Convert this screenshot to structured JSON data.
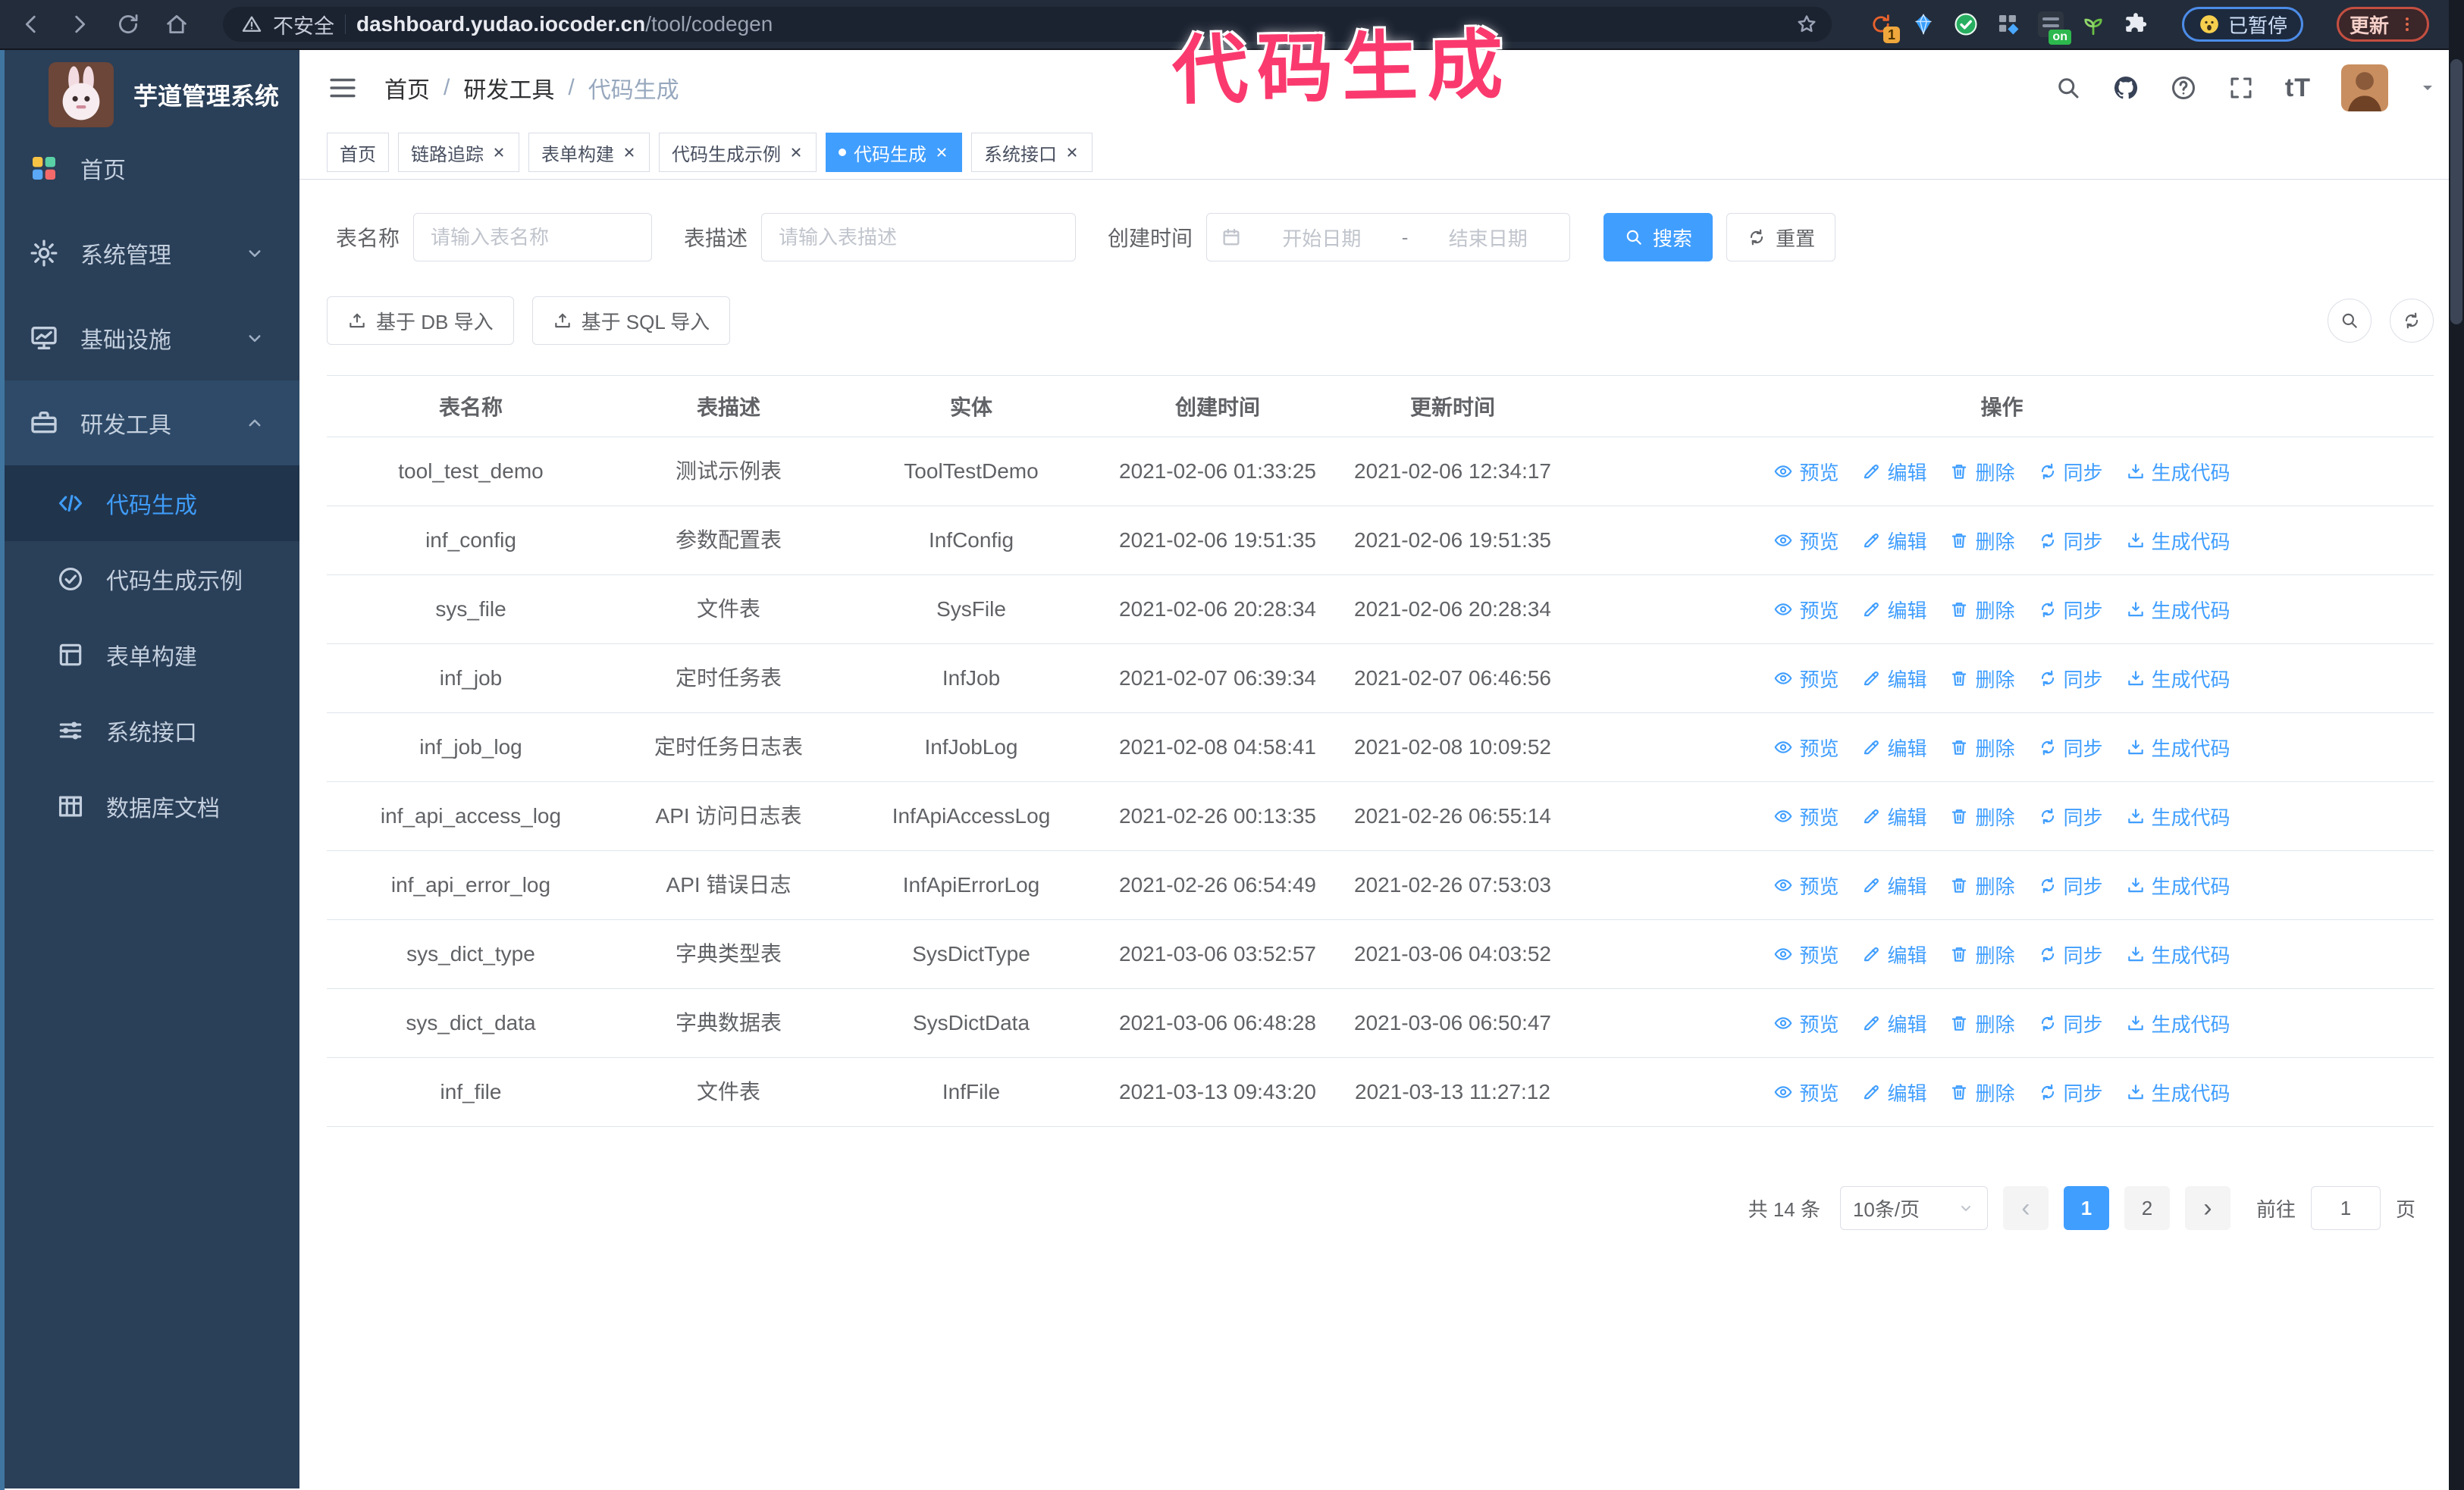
{
  "browser": {
    "security_label": "不安全",
    "url_host": "dashboard.yudao.iocoder.cn",
    "url_path": "/tool/codegen",
    "extension_badge": "1",
    "extension_on_label": "on",
    "paused_label": "已暂停",
    "update_label": "更新"
  },
  "annotation": {
    "text": "代码生成",
    "color": "#fa3a6e"
  },
  "sidebar": {
    "title": "芋道管理系统",
    "items": [
      {
        "key": "home",
        "label": "首页",
        "icon": "dashboard-icon",
        "chevron": null,
        "highlight": false
      },
      {
        "key": "system",
        "label": "系统管理",
        "icon": "gear-icon",
        "chevron": "down",
        "highlight": false
      },
      {
        "key": "infrastructure",
        "label": "基础设施",
        "icon": "monitor-icon",
        "chevron": "down",
        "highlight": false
      },
      {
        "key": "dev-tools",
        "label": "研发工具",
        "icon": "toolbox-icon",
        "chevron": "up",
        "highlight": true
      }
    ],
    "subitems": [
      {
        "key": "codegen",
        "label": "代码生成",
        "icon": "code-icon",
        "active": true
      },
      {
        "key": "codegen-example",
        "label": "代码生成示例",
        "icon": "badge-icon",
        "active": false
      },
      {
        "key": "form-builder",
        "label": "表单构建",
        "icon": "form-icon",
        "active": false
      },
      {
        "key": "system-api",
        "label": "系统接口",
        "icon": "sliders-icon",
        "active": false
      },
      {
        "key": "db-doc",
        "label": "数据库文档",
        "icon": "table-icon",
        "active": false
      }
    ]
  },
  "header": {
    "breadcrumb": [
      "首页",
      "研发工具",
      "代码生成"
    ]
  },
  "tabs": [
    {
      "label": "首页",
      "closable": false,
      "active": false
    },
    {
      "label": "链路追踪",
      "closable": true,
      "active": false
    },
    {
      "label": "表单构建",
      "closable": true,
      "active": false
    },
    {
      "label": "代码生成示例",
      "closable": true,
      "active": false
    },
    {
      "label": "代码生成",
      "closable": true,
      "active": true
    },
    {
      "label": "系统接口",
      "closable": true,
      "active": false
    }
  ],
  "filters": {
    "table_name_label": "表名称",
    "table_name_placeholder": "请输入表名称",
    "table_desc_label": "表描述",
    "table_desc_placeholder": "请输入表描述",
    "create_time_label": "创建时间",
    "date_start_placeholder": "开始日期",
    "date_separator": "-",
    "date_end_placeholder": "结束日期",
    "search_label": "搜索",
    "reset_label": "重置"
  },
  "toolbar": {
    "import_db_label": "基于 DB 导入",
    "import_sql_label": "基于 SQL 导入"
  },
  "table": {
    "columns": [
      "表名称",
      "表描述",
      "实体",
      "创建时间",
      "更新时间",
      "操作"
    ],
    "actions": [
      "预览",
      "编辑",
      "删除",
      "同步",
      "生成代码"
    ],
    "rows": [
      {
        "name": "tool_test_demo",
        "desc": "测试示例表",
        "entity": "ToolTestDemo",
        "created": "2021-02-06 01:33:25",
        "updated": "2021-02-06 12:34:17"
      },
      {
        "name": "inf_config",
        "desc": "参数配置表",
        "entity": "InfConfig",
        "created": "2021-02-06 19:51:35",
        "updated": "2021-02-06 19:51:35"
      },
      {
        "name": "sys_file",
        "desc": "文件表",
        "entity": "SysFile",
        "created": "2021-02-06 20:28:34",
        "updated": "2021-02-06 20:28:34"
      },
      {
        "name": "inf_job",
        "desc": "定时任务表",
        "entity": "InfJob",
        "created": "2021-02-07 06:39:34",
        "updated": "2021-02-07 06:46:56"
      },
      {
        "name": "inf_job_log",
        "desc": "定时任务日志表",
        "entity": "InfJobLog",
        "created": "2021-02-08 04:58:41",
        "updated": "2021-02-08 10:09:52"
      },
      {
        "name": "inf_api_access_log",
        "desc": "API 访问日志表",
        "entity": "InfApiAccessLog",
        "created": "2021-02-26 00:13:35",
        "updated": "2021-02-26 06:55:14"
      },
      {
        "name": "inf_api_error_log",
        "desc": "API 错误日志",
        "entity": "InfApiErrorLog",
        "created": "2021-02-26 06:54:49",
        "updated": "2021-02-26 07:53:03"
      },
      {
        "name": "sys_dict_type",
        "desc": "字典类型表",
        "entity": "SysDictType",
        "created": "2021-03-06 03:52:57",
        "updated": "2021-03-06 04:03:52"
      },
      {
        "name": "sys_dict_data",
        "desc": "字典数据表",
        "entity": "SysDictData",
        "created": "2021-03-06 06:48:28",
        "updated": "2021-03-06 06:50:47"
      },
      {
        "name": "inf_file",
        "desc": "文件表",
        "entity": "InfFile",
        "created": "2021-03-13 09:43:20",
        "updated": "2021-03-13 11:27:12"
      }
    ]
  },
  "pagination": {
    "total": "共 14 条",
    "page_size": "10条/页",
    "pages": [
      "1",
      "2"
    ],
    "active_page": "1",
    "goto_label": "前往",
    "goto_value": "1",
    "page_unit": "页"
  }
}
